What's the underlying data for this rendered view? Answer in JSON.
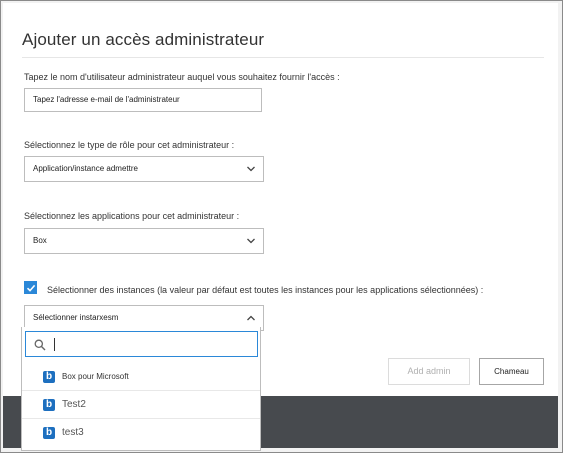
{
  "dialog": {
    "title": "Ajouter un accès administrateur"
  },
  "username": {
    "label": "Tapez le nom d'utilisateur administrateur auquel vous souhaitez fournir l'accès :",
    "placeholder": "Tapez l'adresse e-mail de l'administrateur"
  },
  "role": {
    "label": "Sélectionnez le type de rôle pour cet administrateur :",
    "selected": "Application/instance admettre"
  },
  "applications": {
    "label": "Sélectionnez les applications pour cet administrateur :",
    "selected": "Box"
  },
  "instances": {
    "checkbox_checked": true,
    "checkbox_label": "Sélectionner des instances (la valeur par défaut est toutes les instances pour les applications sélectionnées) :",
    "select_label": "Sélectionner instarxesm",
    "search_value": "",
    "options": [
      {
        "label": "Box pour Microsoft",
        "icon": "box-app-icon"
      },
      {
        "label": "Test2",
        "icon": "box-app-icon"
      },
      {
        "label": "test3",
        "icon": "box-app-icon"
      }
    ]
  },
  "buttons": {
    "add_label": "Add admin",
    "cancel_label": "Chameau"
  },
  "colors": {
    "accent": "#2b88d8",
    "app_icon": "#1d6fbf",
    "footer": "#474a4e"
  }
}
